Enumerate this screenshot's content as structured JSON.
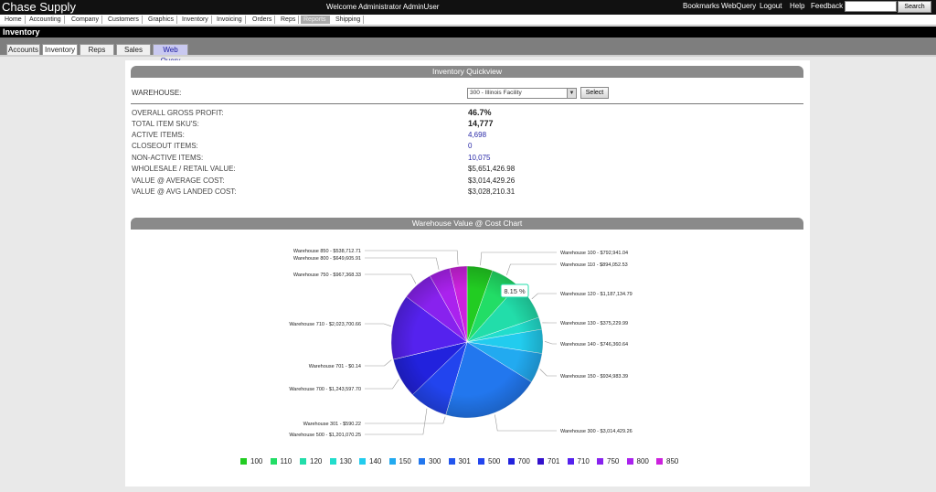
{
  "header": {
    "brand": "Chase Supply",
    "welcome": "Welcome  Administrator AdminUser",
    "links": [
      "Bookmarks",
      "WebQuery",
      "Logout",
      "Help",
      "Feedback"
    ],
    "search_value": "",
    "search_label": "Search"
  },
  "nav": {
    "items": [
      "Home",
      "Accounting",
      "Company",
      "Customers",
      "Graphics",
      "Inventory",
      "Invoicing",
      "Orders",
      "Reps",
      "Reports",
      "Shipping"
    ],
    "active": "Reports"
  },
  "page": {
    "title": "Inventory",
    "tabs": [
      "Accounts",
      "Inventory",
      "Reps",
      "Sales",
      "Web Query"
    ],
    "active_tab": "Inventory"
  },
  "quickview": {
    "heading": "Inventory Quickview",
    "warehouse_label": "WAREHOUSE:",
    "warehouse_selected": "300 - Illinois Facility",
    "select_label": "Select",
    "stats": [
      {
        "label": "OVERALL GROSS PROFIT:",
        "value": "46.7%"
      },
      {
        "label": "TOTAL ITEM SKU'S:",
        "value": "14,777"
      },
      {
        "label": "ACTIVE ITEMS:",
        "value": "4,698"
      },
      {
        "label": "CLOSEOUT ITEMS:",
        "value": "0"
      },
      {
        "label": "NON-ACTIVE ITEMS:",
        "value": "10,075"
      },
      {
        "label": "WHOLESALE / RETAIL VALUE:",
        "value": "$5,651,426.98"
      },
      {
        "label": "VALUE @ AVERAGE COST:",
        "value": "$3,014,429.26"
      },
      {
        "label": "VALUE @ AVG LANDED COST:",
        "value": "$3,028,210.31"
      }
    ]
  },
  "chart_section": {
    "heading": "Warehouse Value @ Cost Chart",
    "tooltip": "8.15 %"
  },
  "chart_data": {
    "type": "pie",
    "title": "",
    "slices": [
      {
        "label": "Warehouse 100 - $792,941.04",
        "legend": "100",
        "value": 792941.04,
        "color": "#22cc22"
      },
      {
        "label": "Warehouse 110 - $894,052.53",
        "legend": "110",
        "value": 894052.53,
        "color": "#22dd66"
      },
      {
        "label": "Warehouse 120 - $1,187,134.79",
        "legend": "120",
        "value": 1187134.79,
        "color": "#22ddaa"
      },
      {
        "label": "Warehouse 130 - $375,229.99",
        "legend": "130",
        "value": 375229.99,
        "color": "#22ddcc"
      },
      {
        "label": "Warehouse 140 - $746,360.64",
        "legend": "140",
        "value": 746360.64,
        "color": "#22ccee"
      },
      {
        "label": "Warehouse 150 - $934,983.39",
        "legend": "150",
        "value": 934983.39,
        "color": "#22aaf0"
      },
      {
        "label": "Warehouse 300 - $3,014,429.26",
        "legend": "300",
        "value": 3014429.26,
        "color": "#2277ee"
      },
      {
        "label": "Warehouse 301 - $590.22",
        "legend": "301",
        "value": 590.22,
        "color": "#2255ee"
      },
      {
        "label": "Warehouse 500 - $1,201,070.25",
        "legend": "500",
        "value": 1201070.25,
        "color": "#2244ee"
      },
      {
        "label": "Warehouse 700 - $1,243,597.70",
        "legend": "700",
        "value": 1243597.7,
        "color": "#2222dd"
      },
      {
        "label": "Warehouse 701 - $0.14",
        "legend": "701",
        "value": 0.14,
        "color": "#3311cc"
      },
      {
        "label": "Warehouse 710 - $2,023,700.66",
        "legend": "710",
        "value": 2023700.66,
        "color": "#5522ee"
      },
      {
        "label": "Warehouse 750 - $967,368.33",
        "legend": "750",
        "value": 967368.33,
        "color": "#8822ee"
      },
      {
        "label": "Warehouse 800 - $649,605.91",
        "legend": "800",
        "value": 649605.91,
        "color": "#aa22ee"
      },
      {
        "label": "Warehouse 850 - $538,712.71",
        "legend": "850",
        "value": 538712.71,
        "color": "#cc22dd"
      }
    ],
    "legend_placement": "bottom",
    "highlighted_slice": "120"
  }
}
